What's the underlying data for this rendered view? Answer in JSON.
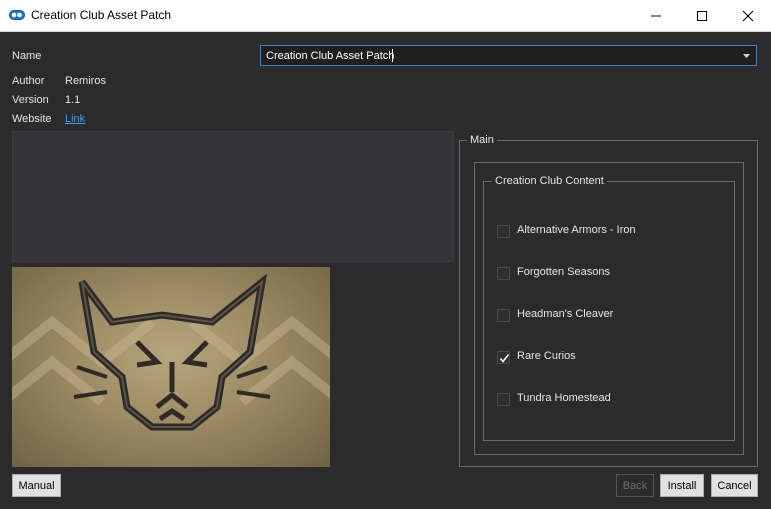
{
  "window": {
    "title": "Creation Club Asset Patch",
    "icon": "cloud-icon",
    "controls": [
      "minimize-icon",
      "maximize-icon",
      "close-icon"
    ]
  },
  "info": {
    "name_label": "Name",
    "name_value": "Creation Club Asset Patch",
    "author_label": "Author",
    "author_value": "Remiros",
    "version_label": "Version",
    "version_value": "1.1",
    "website_label": "Website",
    "website_link_text": "Link"
  },
  "description": "",
  "image_icon": "cat-head-emblem-icon",
  "main_group": {
    "label": "Main",
    "subgroup_label": "Creation Club Content",
    "options": [
      {
        "label": "Alternative Armors - Iron",
        "checked": false
      },
      {
        "label": "Forgotten Seasons",
        "checked": false
      },
      {
        "label": "Headman's Cleaver",
        "checked": false
      },
      {
        "label": "Rare Curios",
        "checked": true
      },
      {
        "label": "Tundra Homestead",
        "checked": false
      }
    ]
  },
  "buttons": {
    "manual": "Manual",
    "back": "Back",
    "install": "Install",
    "cancel": "Cancel"
  },
  "colors": {
    "background": "#2b2b2b",
    "link": "#3b9cff",
    "focus_border": "#3d7fd6"
  }
}
